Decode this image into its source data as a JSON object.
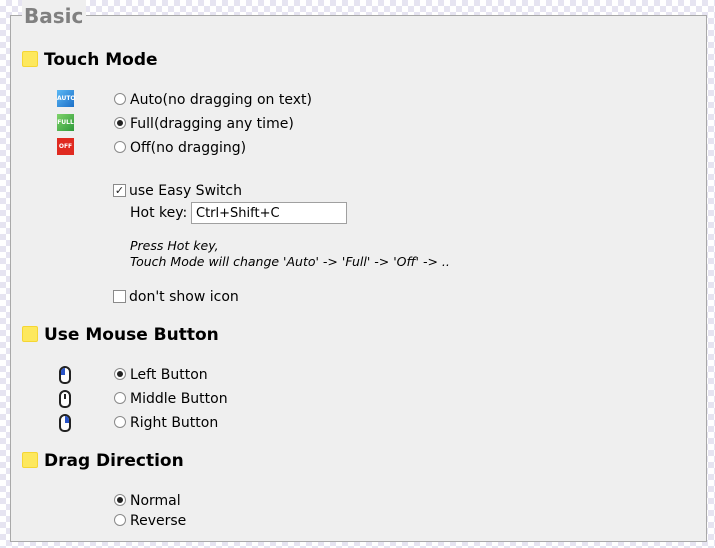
{
  "legend": "Basic",
  "touch_mode": {
    "title": "Touch Mode",
    "options": [
      {
        "label": "Auto(no dragging on text)",
        "icon_text": "AUTO",
        "icon": "auto-mode-icon",
        "color": "#2f8fe0",
        "selected": false
      },
      {
        "label": "Full(dragging any time)",
        "icon_text": "FULL",
        "icon": "full-mode-icon",
        "color": "#3bb54a",
        "selected": true
      },
      {
        "label": "Off(no dragging)",
        "icon_text": "OFF",
        "icon": "off-mode-icon",
        "color": "#e02a20",
        "selected": false
      }
    ],
    "easy_switch_label": "use Easy Switch",
    "easy_switch_checked": true,
    "hotkey_label": "Hot key:",
    "hotkey_value": "Ctrl+Shift+C",
    "hint_line1": "Press Hot key,",
    "hint_line2": "Touch Mode will change 'Auto' -> 'Full' -> 'Off' -> ..",
    "dont_show_icon_label": "don't show icon",
    "dont_show_icon_checked": false
  },
  "mouse_button": {
    "title": "Use Mouse Button",
    "options": [
      {
        "label": "Left Button",
        "icon": "left-mouse-button-icon",
        "selected": true
      },
      {
        "label": "Middle Button",
        "icon": "middle-mouse-button-icon",
        "selected": false
      },
      {
        "label": "Right Button",
        "icon": "right-mouse-button-icon",
        "selected": false
      }
    ]
  },
  "drag_direction": {
    "title": "Drag Direction",
    "options": [
      {
        "label": "Normal",
        "selected": true
      },
      {
        "label": "Reverse",
        "selected": false
      }
    ]
  },
  "colors": {
    "accent": "#2a55c9",
    "panel": "#efefef",
    "legend_text": "#808080",
    "bullet": "#fde85d"
  }
}
